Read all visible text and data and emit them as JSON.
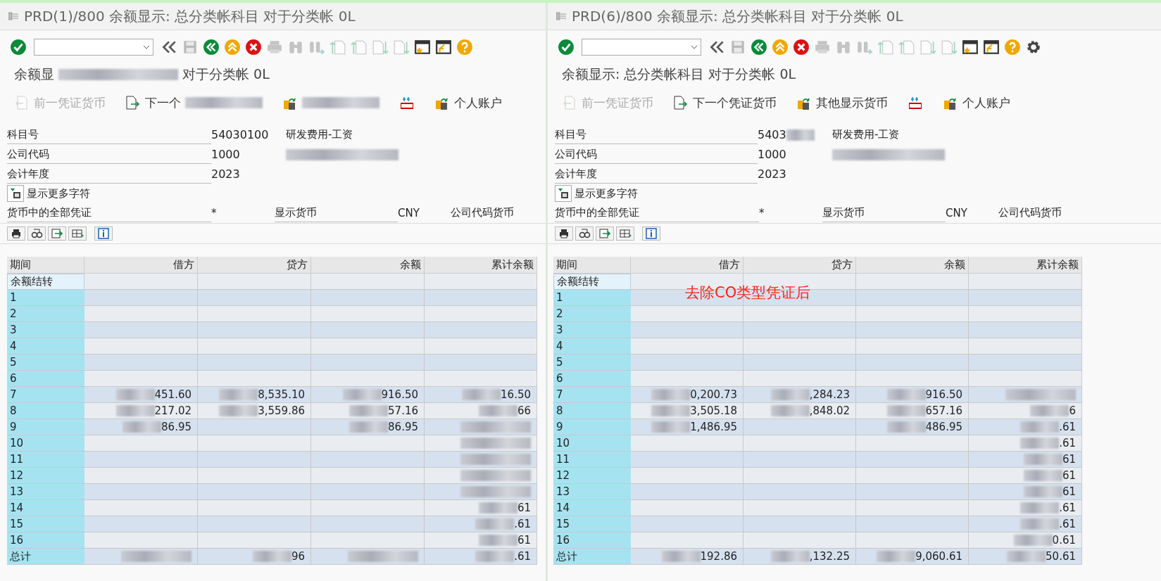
{
  "panes": [
    {
      "title": "PRD(1)/800 余额显示: 总分类帐科目 对于分类帐 0L",
      "toolbar": [
        {
          "kind": "check",
          "disabled": false
        },
        {
          "kind": "command_field"
        },
        {
          "kind": "chevrons",
          "disabled": false
        },
        {
          "kind": "save",
          "disabled": true
        },
        {
          "kind": "back",
          "disabled": false
        },
        {
          "kind": "exit",
          "disabled": false
        },
        {
          "kind": "cancel",
          "disabled": false
        },
        {
          "kind": "print",
          "disabled": true
        },
        {
          "kind": "find",
          "disabled": true
        },
        {
          "kind": "find_next",
          "disabled": true
        },
        {
          "kind": "page_first",
          "disabled": true
        },
        {
          "kind": "page_prev",
          "disabled": true
        },
        {
          "kind": "page_next",
          "disabled": true
        },
        {
          "kind": "page_last",
          "disabled": true
        },
        {
          "kind": "new_session",
          "disabled": false
        },
        {
          "kind": "shortcut",
          "disabled": false
        },
        {
          "kind": "help",
          "disabled": false
        }
      ],
      "subtitle": [
        {
          "text": "余额显",
          "redacted": true
        },
        {
          "text": "对于分类帐 0L"
        }
      ],
      "app_toolbar": [
        {
          "kind": "prev_doc",
          "label": "前一凭证货币",
          "disabled": true
        },
        {
          "kind": "next_doc",
          "label": "下一个",
          "disabled": false,
          "redacted": true
        },
        {
          "kind": "other_currency",
          "disabled": false,
          "redacted": true
        },
        {
          "kind": "money",
          "disabled": false
        },
        {
          "kind": "account",
          "label": "个人账户",
          "disabled": false
        }
      ],
      "fields": [
        {
          "label": "科目号",
          "value": "54030100",
          "description": "研发费用-工资"
        },
        {
          "label": "公司代码",
          "value": "1000",
          "description_redacted": true
        },
        {
          "label": "会计年度",
          "value": "2023"
        }
      ],
      "more_button": "显示更多字符",
      "currency": {
        "label": "货币中的全部凭证",
        "value": "*",
        "display_label": "显示货币",
        "display_value": "CNY",
        "company_label": "公司代码货币"
      },
      "alv_toolbar": [
        {
          "kind": "print"
        },
        {
          "kind": "view"
        },
        {
          "kind": "export"
        },
        {
          "kind": "layout"
        },
        {
          "kind": "info"
        }
      ],
      "columns": [
        "期间",
        "借方",
        "贷方",
        "余额",
        "累计余额"
      ],
      "rows": [
        {
          "focused": true,
          "cells": [
            {
              "value": "余额结转"
            },
            {},
            {},
            {},
            {}
          ]
        },
        {
          "focused": false,
          "cells": [
            {
              "value": "1"
            },
            {},
            {},
            {},
            {}
          ]
        },
        {
          "focused": false,
          "cells": [
            {
              "value": "2"
            },
            {},
            {},
            {},
            {}
          ]
        },
        {
          "focused": false,
          "cells": [
            {
              "value": "3"
            },
            {},
            {},
            {},
            {}
          ]
        },
        {
          "focused": false,
          "cells": [
            {
              "value": "4"
            },
            {},
            {},
            {},
            {}
          ]
        },
        {
          "focused": false,
          "cells": [
            {
              "value": "5"
            },
            {},
            {},
            {},
            {}
          ]
        },
        {
          "focused": false,
          "cells": [
            {
              "value": "6"
            },
            {},
            {},
            {},
            {}
          ]
        },
        {
          "focused": false,
          "cells": [
            {
              "value": "7"
            },
            {
              "value": "451.60",
              "redacted": true
            },
            {
              "value": "8,535.10",
              "redacted": true
            },
            {
              "value": "916.50",
              "redacted": true
            },
            {
              "value": "16.50",
              "redacted": true
            }
          ]
        },
        {
          "focused": false,
          "cells": [
            {
              "value": "8"
            },
            {
              "value": "217.02",
              "redacted": true
            },
            {
              "value": "3,559.86",
              "redacted": true
            },
            {
              "value": "57.16",
              "redacted": true
            },
            {
              "value": "66",
              "redacted": true
            }
          ]
        },
        {
          "focused": false,
          "cells": [
            {
              "value": "9"
            },
            {
              "value": "86.95",
              "redacted": true
            },
            {},
            {
              "value": "86.95",
              "redacted": true
            },
            {
              "redacted": true
            }
          ]
        },
        {
          "focused": false,
          "cells": [
            {
              "value": "10"
            },
            {},
            {},
            {},
            {
              "redacted": true
            }
          ]
        },
        {
          "focused": false,
          "cells": [
            {
              "value": "11"
            },
            {},
            {},
            {},
            {
              "redacted": true
            }
          ]
        },
        {
          "focused": false,
          "cells": [
            {
              "value": "12"
            },
            {},
            {},
            {},
            {
              "redacted": true
            }
          ]
        },
        {
          "focused": false,
          "cells": [
            {
              "value": "13"
            },
            {},
            {},
            {},
            {
              "redacted": true
            }
          ]
        },
        {
          "focused": false,
          "cells": [
            {
              "value": "14"
            },
            {},
            {},
            {},
            {
              "value": "61",
              "redacted": true
            }
          ]
        },
        {
          "focused": false,
          "cells": [
            {
              "value": "15"
            },
            {},
            {},
            {},
            {
              "value": ".61",
              "redacted": true
            }
          ]
        },
        {
          "focused": false,
          "cells": [
            {
              "value": "16"
            },
            {},
            {},
            {},
            {
              "value": "61",
              "redacted": true
            }
          ]
        },
        {
          "focused": false,
          "cells": [
            {
              "value": "总计"
            },
            {
              "redacted": true
            },
            {
              "value": "96",
              "redacted": true
            },
            {
              "redacted": true
            },
            {
              "value": ".61",
              "redacted": true
            }
          ]
        }
      ]
    },
    {
      "title": "PRD(6)/800 余额显示: 总分类帐科目 对于分类帐 0L",
      "toolbar": [
        {
          "kind": "check",
          "disabled": false
        },
        {
          "kind": "command_field"
        },
        {
          "kind": "chevrons",
          "disabled": false
        },
        {
          "kind": "save",
          "disabled": true
        },
        {
          "kind": "back",
          "disabled": false
        },
        {
          "kind": "exit",
          "disabled": false
        },
        {
          "kind": "cancel",
          "disabled": false
        },
        {
          "kind": "print",
          "disabled": true
        },
        {
          "kind": "find",
          "disabled": true
        },
        {
          "kind": "find_next",
          "disabled": true
        },
        {
          "kind": "page_first",
          "disabled": true
        },
        {
          "kind": "page_prev",
          "disabled": true
        },
        {
          "kind": "page_next",
          "disabled": true
        },
        {
          "kind": "page_last",
          "disabled": true
        },
        {
          "kind": "new_session",
          "disabled": false
        },
        {
          "kind": "shortcut",
          "disabled": false
        },
        {
          "kind": "help",
          "disabled": false
        },
        {
          "kind": "settings",
          "disabled": false
        }
      ],
      "subtitle": [
        {
          "text": "余额显示: 总分类帐科目 对于分类帐 0L"
        }
      ],
      "app_toolbar": [
        {
          "kind": "prev_doc",
          "label": "前一凭证货币",
          "disabled": true
        },
        {
          "kind": "next_doc",
          "label": "下一个凭证货币",
          "disabled": false
        },
        {
          "kind": "other_currency",
          "label": "其他显示货币",
          "disabled": false
        },
        {
          "kind": "money",
          "disabled": false
        },
        {
          "kind": "account",
          "label": "个人账户",
          "disabled": false
        }
      ],
      "fields": [
        {
          "label": "科目号",
          "value": "5403",
          "value_redacted": true,
          "description": "研发费用-工资"
        },
        {
          "label": "公司代码",
          "value": "1000",
          "description_redacted": true
        },
        {
          "label": "会计年度",
          "value": "2023"
        }
      ],
      "more_button": "显示更多字符",
      "currency": {
        "label": "货币中的全部凭证",
        "value": "*",
        "display_label": "显示货币",
        "display_value": "CNY",
        "company_label": "公司代码货币"
      },
      "alv_toolbar": [
        {
          "kind": "print"
        },
        {
          "kind": "view"
        },
        {
          "kind": "export"
        },
        {
          "kind": "layout"
        },
        {
          "kind": "info"
        }
      ],
      "columns": [
        "期间",
        "借方",
        "贷方",
        "余额",
        "累计余额"
      ],
      "annotation": "去除CO类型凭证后",
      "rows": [
        {
          "focused": true,
          "cells": [
            {
              "value": "余额结转"
            },
            {},
            {},
            {},
            {}
          ]
        },
        {
          "focused": false,
          "cells": [
            {
              "value": "1"
            },
            {},
            {},
            {},
            {}
          ]
        },
        {
          "focused": false,
          "cells": [
            {
              "value": "2"
            },
            {},
            {},
            {},
            {}
          ]
        },
        {
          "focused": false,
          "cells": [
            {
              "value": "3"
            },
            {},
            {},
            {},
            {}
          ]
        },
        {
          "focused": false,
          "cells": [
            {
              "value": "4"
            },
            {},
            {},
            {},
            {}
          ]
        },
        {
          "focused": false,
          "cells": [
            {
              "value": "5"
            },
            {},
            {},
            {},
            {}
          ]
        },
        {
          "focused": false,
          "cells": [
            {
              "value": "6"
            },
            {},
            {},
            {},
            {}
          ]
        },
        {
          "focused": false,
          "cells": [
            {
              "value": "7"
            },
            {
              "value": "0,200.73",
              "redacted": true
            },
            {
              "value": ",284.23",
              "redacted": true
            },
            {
              "value": "916.50",
              "redacted": true
            },
            {
              "redacted": true
            }
          ]
        },
        {
          "focused": false,
          "cells": [
            {
              "value": "8"
            },
            {
              "value": "3,505.18",
              "redacted": true
            },
            {
              "value": ",848.02",
              "redacted": true
            },
            {
              "value": "657.16",
              "redacted": true
            },
            {
              "value": "6",
              "redacted": true
            }
          ]
        },
        {
          "focused": false,
          "cells": [
            {
              "value": "9"
            },
            {
              "value": "1,486.95",
              "redacted": true
            },
            {},
            {
              "value": "486.95",
              "redacted": true
            },
            {
              "value": ".61",
              "redacted": true
            }
          ]
        },
        {
          "focused": false,
          "cells": [
            {
              "value": "10"
            },
            {},
            {},
            {},
            {
              "value": ".61",
              "redacted": true
            }
          ]
        },
        {
          "focused": false,
          "cells": [
            {
              "value": "11"
            },
            {},
            {},
            {},
            {
              "value": "61",
              "redacted": true
            }
          ]
        },
        {
          "focused": false,
          "cells": [
            {
              "value": "12"
            },
            {},
            {},
            {},
            {
              "value": "61",
              "redacted": true
            }
          ]
        },
        {
          "focused": false,
          "cells": [
            {
              "value": "13"
            },
            {},
            {},
            {},
            {
              "value": "61",
              "redacted": true
            }
          ]
        },
        {
          "focused": false,
          "cells": [
            {
              "value": "14"
            },
            {},
            {},
            {},
            {
              "value": ".61",
              "redacted": true
            }
          ]
        },
        {
          "focused": false,
          "cells": [
            {
              "value": "15"
            },
            {},
            {},
            {},
            {
              "value": ".61",
              "redacted": true
            }
          ]
        },
        {
          "focused": false,
          "cells": [
            {
              "value": "16"
            },
            {},
            {},
            {},
            {
              "value": "0.61",
              "redacted": true
            }
          ]
        },
        {
          "focused": false,
          "cells": [
            {
              "value": "总计"
            },
            {
              "value": "192.86",
              "redacted": true
            },
            {
              "value": ",132.25",
              "redacted": true
            },
            {
              "value": "9,060.61",
              "redacted": true
            },
            {
              "value": "50.61",
              "redacted": true
            }
          ]
        }
      ]
    }
  ]
}
